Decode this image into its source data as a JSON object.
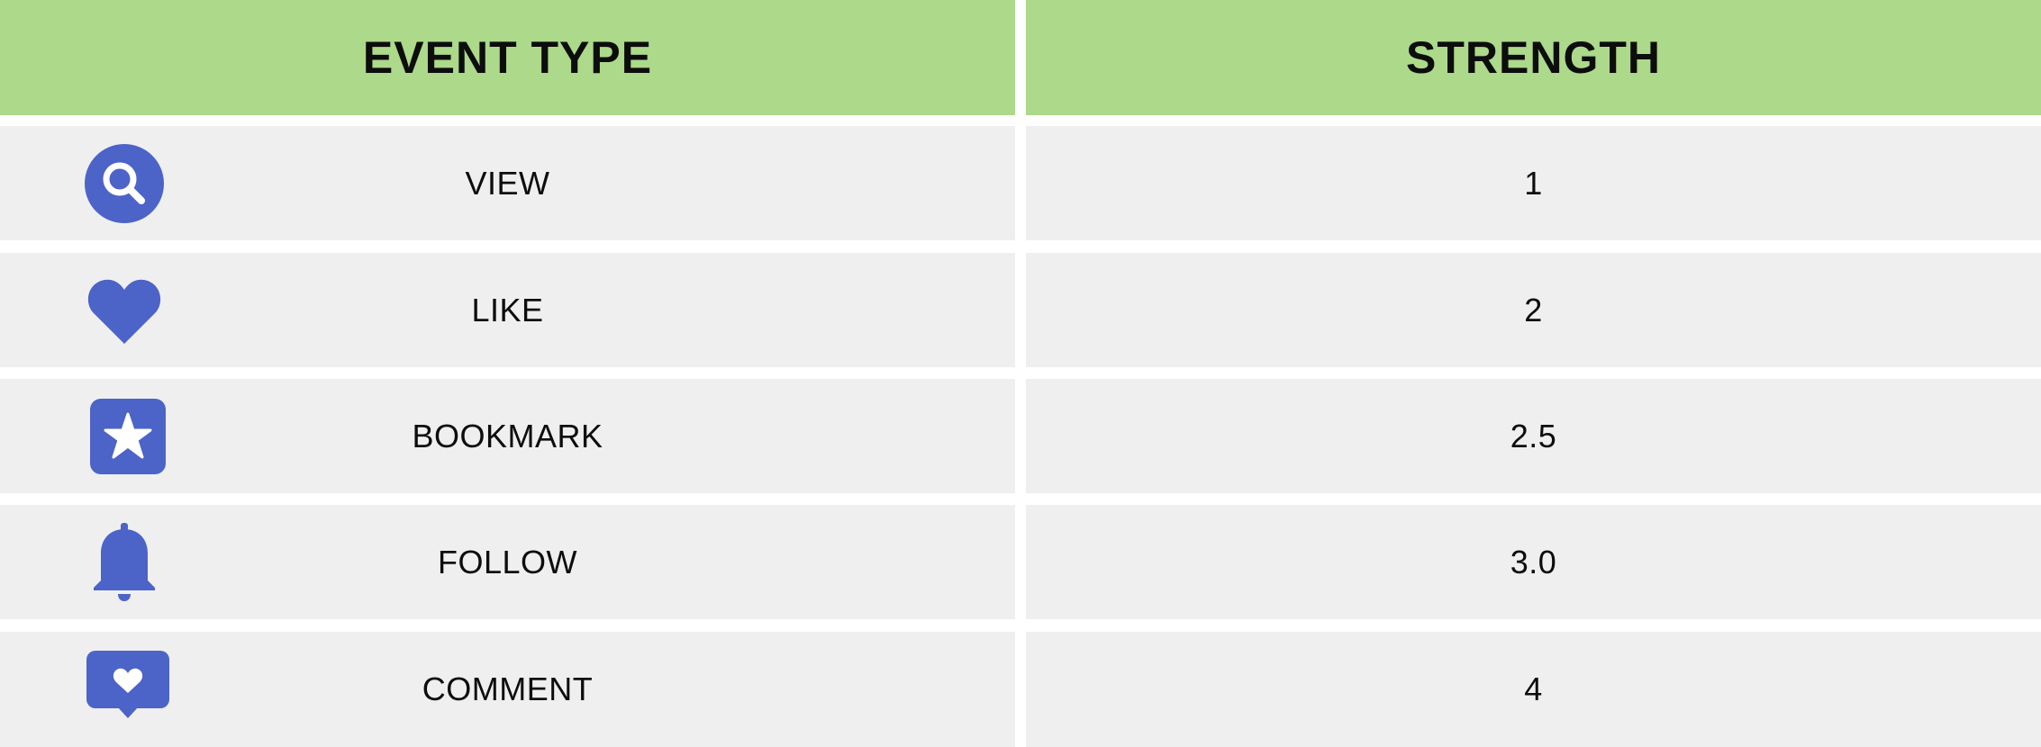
{
  "header": {
    "event_type": "EVENT TYPE",
    "strength": "STRENGTH"
  },
  "colors": {
    "header_bg": "#acd98a",
    "row_bg": "#efefef",
    "icon": "#4c63c8"
  },
  "rows": [
    {
      "icon": "search-icon",
      "event": "VIEW",
      "strength": "1"
    },
    {
      "icon": "heart-icon",
      "event": "LIKE",
      "strength": "2"
    },
    {
      "icon": "star-bookmark-icon",
      "event": "BOOKMARK",
      "strength": "2.5"
    },
    {
      "icon": "bell-icon",
      "event": "FOLLOW",
      "strength": "3.0"
    },
    {
      "icon": "comment-heart-icon",
      "event": "COMMENT",
      "strength": "4"
    }
  ]
}
